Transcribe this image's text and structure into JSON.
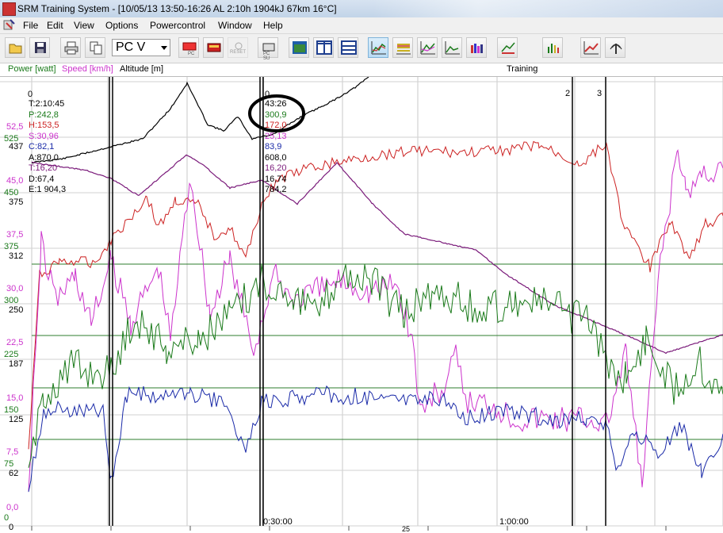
{
  "window": {
    "title": "SRM Training System - [10/05/13 13:50-16:26 AL 2:10h 1904kJ 67km 16°C]"
  },
  "menu": [
    "File",
    "Edit",
    "View",
    "Options",
    "Powercontrol",
    "Window",
    "Help"
  ],
  "toolbar": {
    "profile_value": "PC V",
    "reset_label": "RESET",
    "pc_label": "PC",
    "pcsu_label": "PC SU"
  },
  "legend": {
    "power": "Power [watt]",
    "speed": "Speed [km/h]",
    "altitude": "Altitude [m]",
    "mode": "Training"
  },
  "colors": {
    "power": "#1a7a1a",
    "speed": "#cc33cc",
    "altitude": "#000000",
    "heart_rate": "#cc2222",
    "cadence": "#1a2aa8",
    "temperature": "#7a1a7a"
  },
  "axis_labels": [
    {
      "text": "52,5",
      "color": "#cc33cc"
    },
    {
      "text": "525",
      "color": "#1a7a1a"
    },
    {
      "text": "437",
      "color": "#000000"
    },
    {
      "text": "45,0",
      "color": "#cc33cc"
    },
    {
      "text": "450",
      "color": "#1a7a1a"
    },
    {
      "text": "375",
      "color": "#000000"
    },
    {
      "text": "37,5",
      "color": "#cc33cc"
    },
    {
      "text": "375",
      "color": "#1a7a1a"
    },
    {
      "text": "312",
      "color": "#000000"
    },
    {
      "text": "30,0",
      "color": "#cc33cc"
    },
    {
      "text": "300",
      "color": "#1a7a1a"
    },
    {
      "text": "250",
      "color": "#000000"
    },
    {
      "text": "22,5",
      "color": "#cc33cc"
    },
    {
      "text": "225",
      "color": "#1a7a1a"
    },
    {
      "text": "187",
      "color": "#000000"
    },
    {
      "text": "15,0",
      "color": "#cc33cc"
    },
    {
      "text": "150",
      "color": "#1a7a1a"
    },
    {
      "text": "125",
      "color": "#000000"
    },
    {
      "text": "7,5",
      "color": "#cc33cc"
    },
    {
      "text": "75",
      "color": "#1a7a1a"
    },
    {
      "text": "62",
      "color": "#000000"
    },
    {
      "text": "0,0",
      "color": "#cc33cc"
    },
    {
      "text": "0",
      "color": "#1a7a1a"
    },
    {
      "text": "0",
      "color": "#000000"
    }
  ],
  "time_labels": [
    "0:30:00",
    "1:00:00",
    "25"
  ],
  "markers": [
    "0",
    "2",
    "3",
    "0"
  ],
  "stats_left": [
    {
      "text": "T:2:10:45",
      "color": "#000000"
    },
    {
      "text": "P:242,8",
      "color": "#1a7a1a"
    },
    {
      "text": "H:153,5",
      "color": "#cc2222"
    },
    {
      "text": "S:30,96",
      "color": "#cc33cc"
    },
    {
      "text": "C:82,1",
      "color": "#1a2aa8"
    },
    {
      "text": "A:870,0",
      "color": "#000000"
    },
    {
      "text": "T:16,20",
      "color": "#7a1a7a"
    },
    {
      "text": "D:67,4",
      "color": "#000000"
    },
    {
      "text": "E:1 904,3",
      "color": "#000000"
    }
  ],
  "stats_right": [
    {
      "text": "43:26",
      "color": "#000000"
    },
    {
      "text": "300,9",
      "color": "#1a7a1a"
    },
    {
      "text": "172,0",
      "color": "#cc2222"
    },
    {
      "text": "25,13",
      "color": "#cc33cc"
    },
    {
      "text": "83,9",
      "color": "#1a2aa8"
    },
    {
      "text": "608,0",
      "color": "#000000"
    },
    {
      "text": "16,20",
      "color": "#7a1a7a"
    },
    {
      "text": "16,74",
      "color": "#000000"
    },
    {
      "text": "784,2",
      "color": "#000000"
    }
  ]
}
